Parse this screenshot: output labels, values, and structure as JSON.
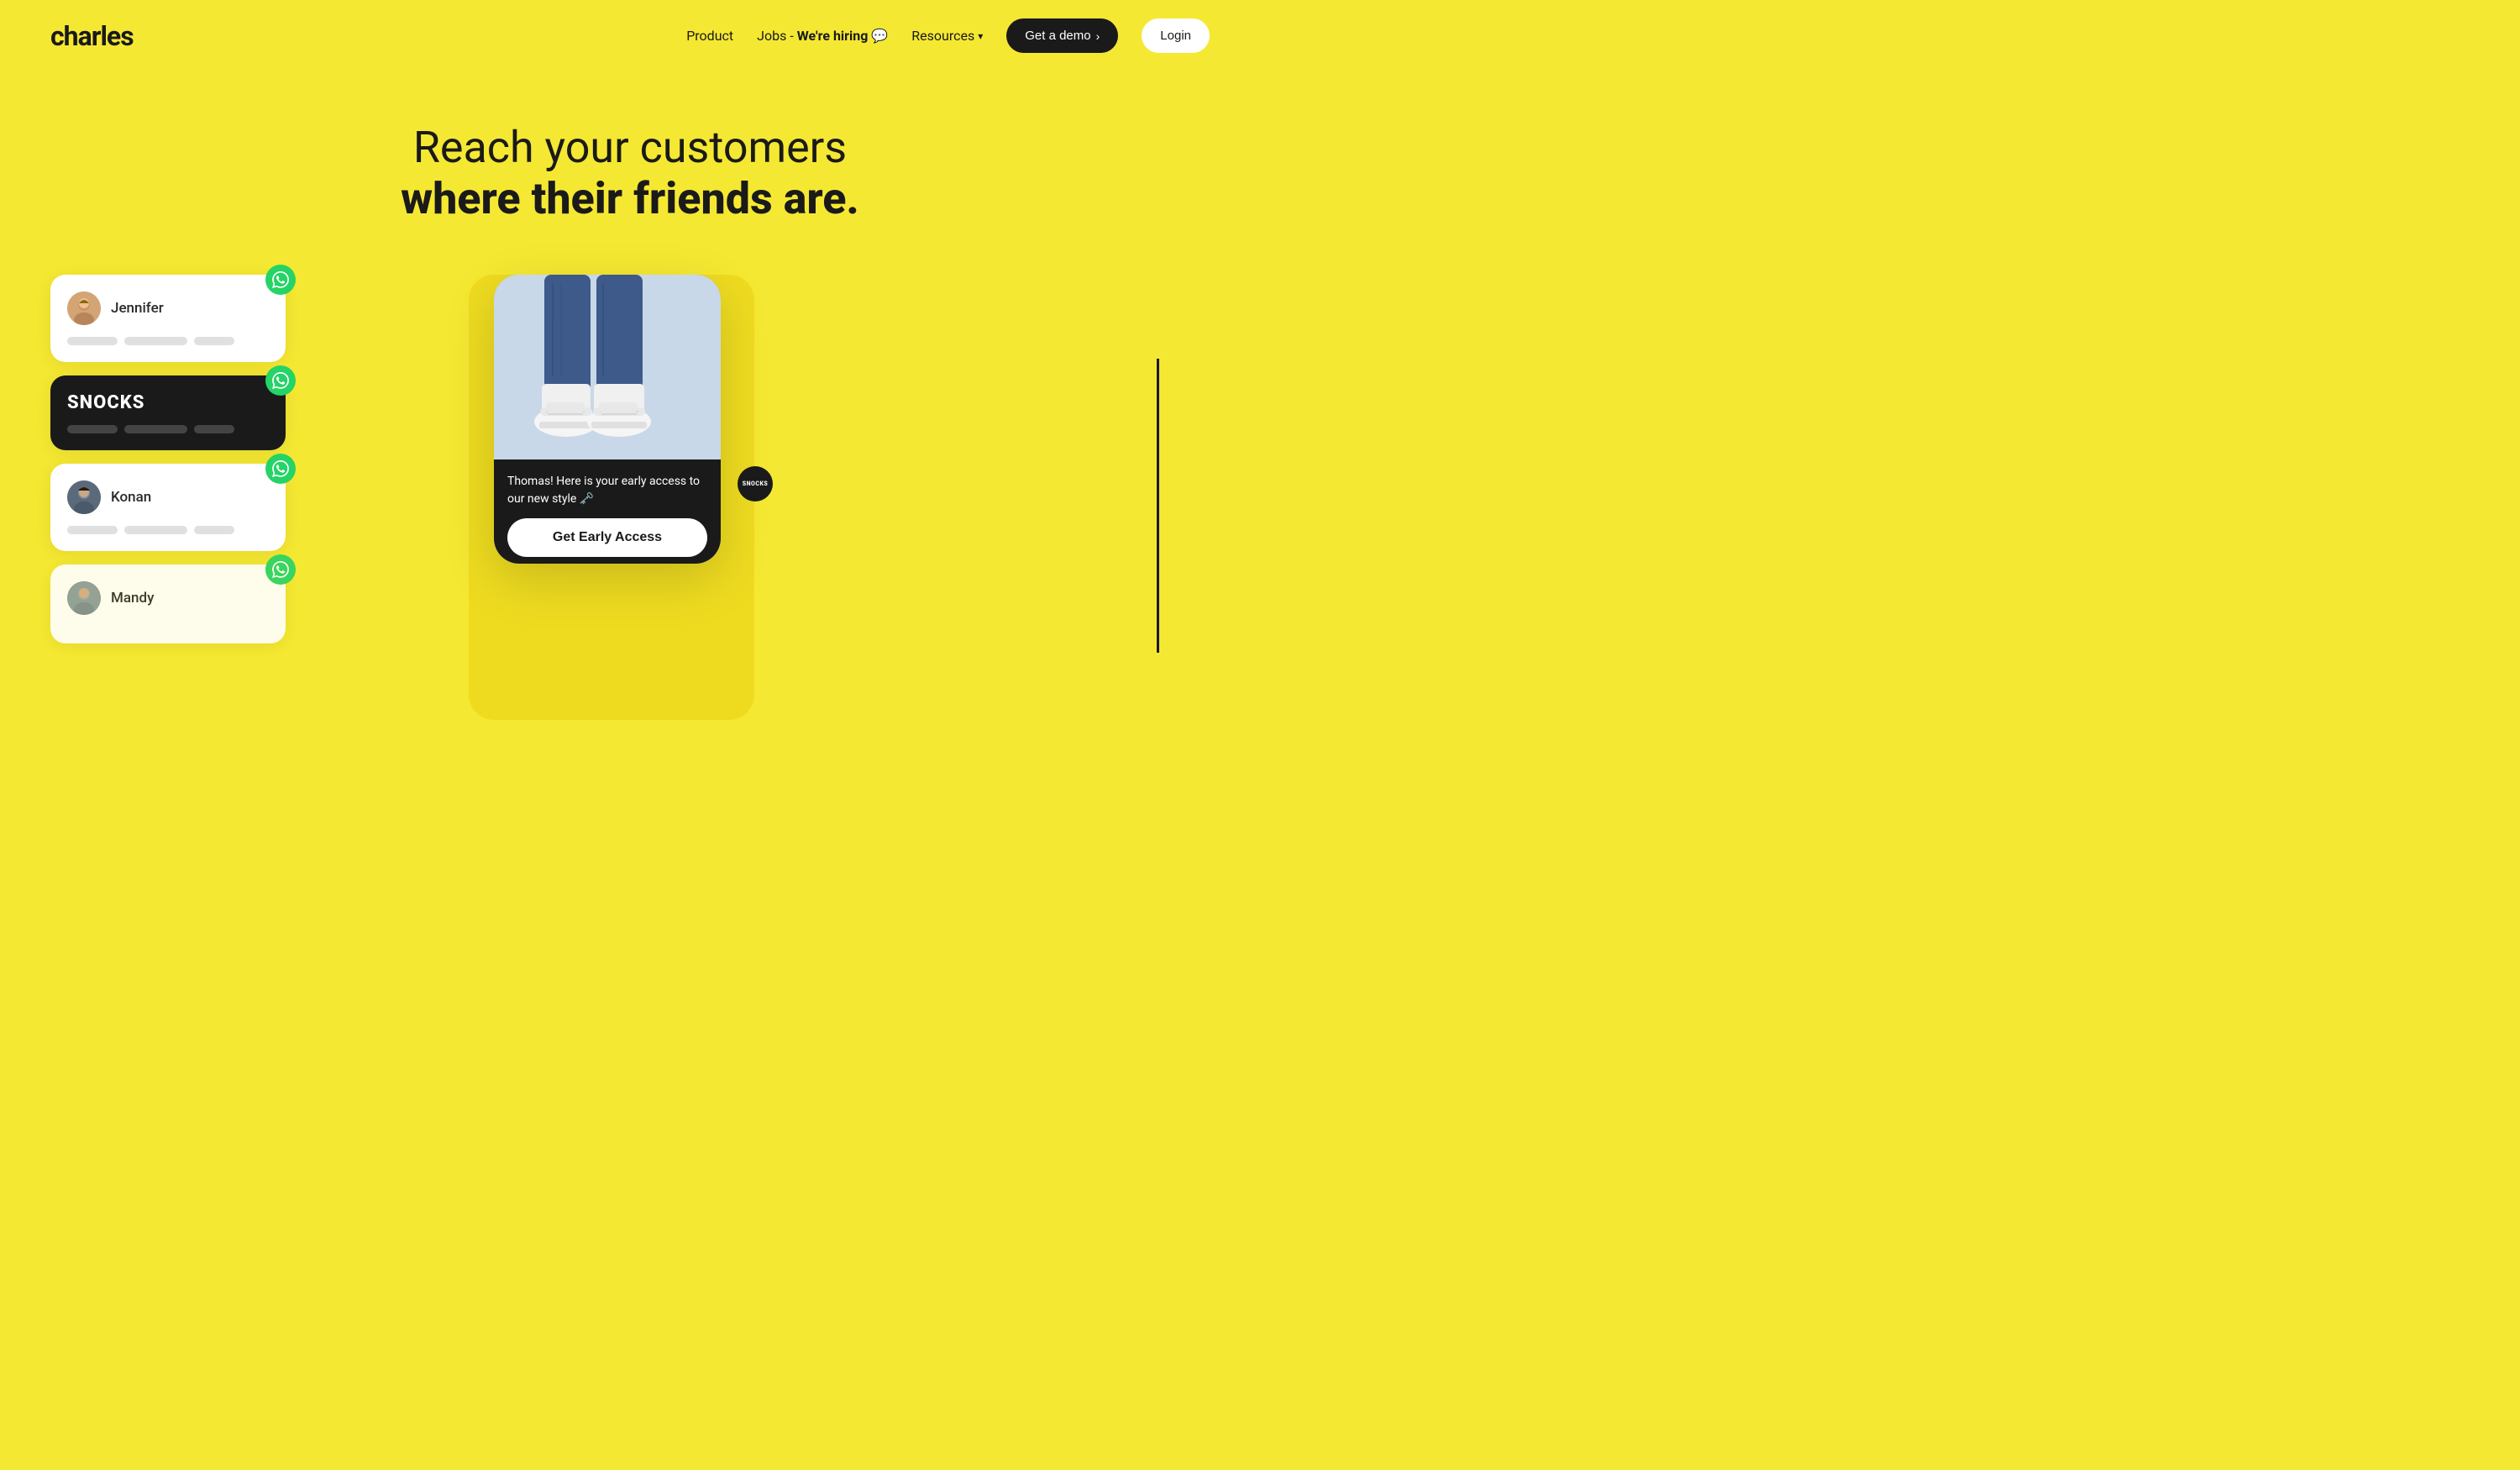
{
  "brand": {
    "name": "charles"
  },
  "navbar": {
    "product_label": "Product",
    "jobs_label": "Jobs",
    "jobs_hiring": "We're hiring",
    "jobs_emoji": "💬",
    "resources_label": "Resources",
    "get_demo_label": "Get a demo",
    "get_demo_arrow": "›",
    "login_label": "Login"
  },
  "hero": {
    "headline_line1": "Reach your customers",
    "headline_line2": "where their friends are."
  },
  "contacts": [
    {
      "name": "Jennifer",
      "type": "light",
      "avatar_type": "jennifer"
    },
    {
      "name": "SNOCKS",
      "type": "dark",
      "avatar_type": "none"
    },
    {
      "name": "Konan",
      "type": "light",
      "avatar_type": "konan"
    },
    {
      "name": "Mandy",
      "type": "light",
      "avatar_type": "mandy"
    }
  ],
  "phone_message": {
    "text": "Thomas! Here is your early access to our new style 🗝️",
    "cta": "Get Early Access"
  },
  "snocks_badge": "SNOCKS",
  "colors": {
    "bg_yellow": "#f5e832",
    "black": "#1a1a1a",
    "white": "#ffffff",
    "whatsapp_green": "#25d366"
  }
}
